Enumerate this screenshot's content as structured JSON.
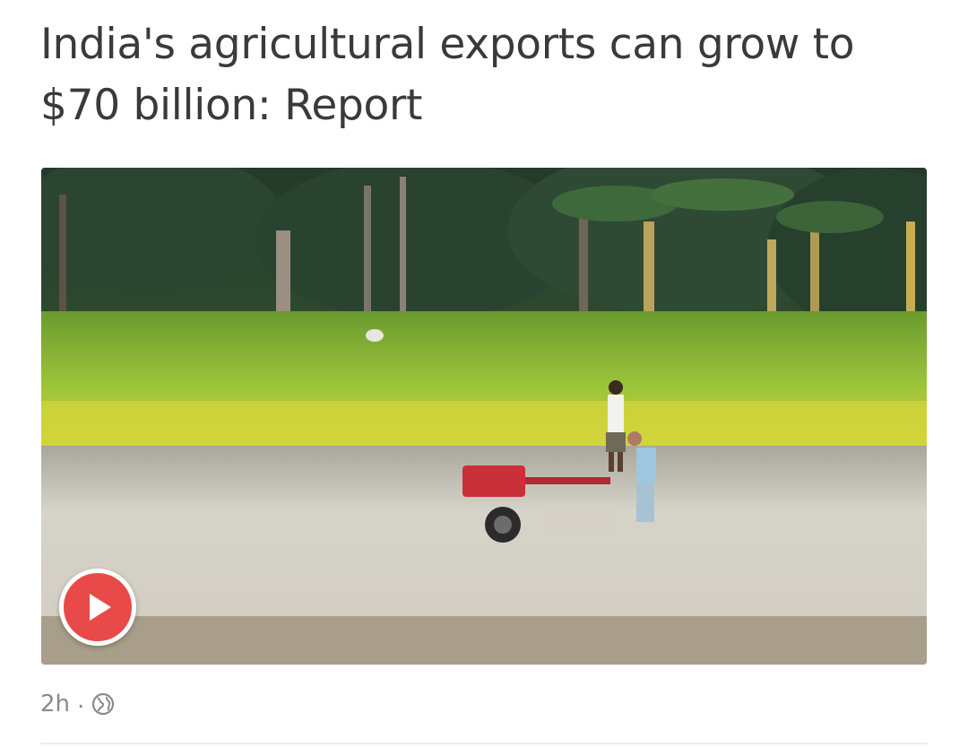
{
  "post": {
    "headline": "India's agricultural exports can grow to $70 billion: Report",
    "media": {
      "type": "video",
      "alt": "",
      "play_icon": "play-icon"
    },
    "meta": {
      "time": "2h",
      "separator": ".",
      "visibility_icon": "globe-icon"
    }
  },
  "colors": {
    "headline": "#3a3a3a",
    "play_button": "#e84a4a",
    "meta_text": "#8a8a8a"
  }
}
